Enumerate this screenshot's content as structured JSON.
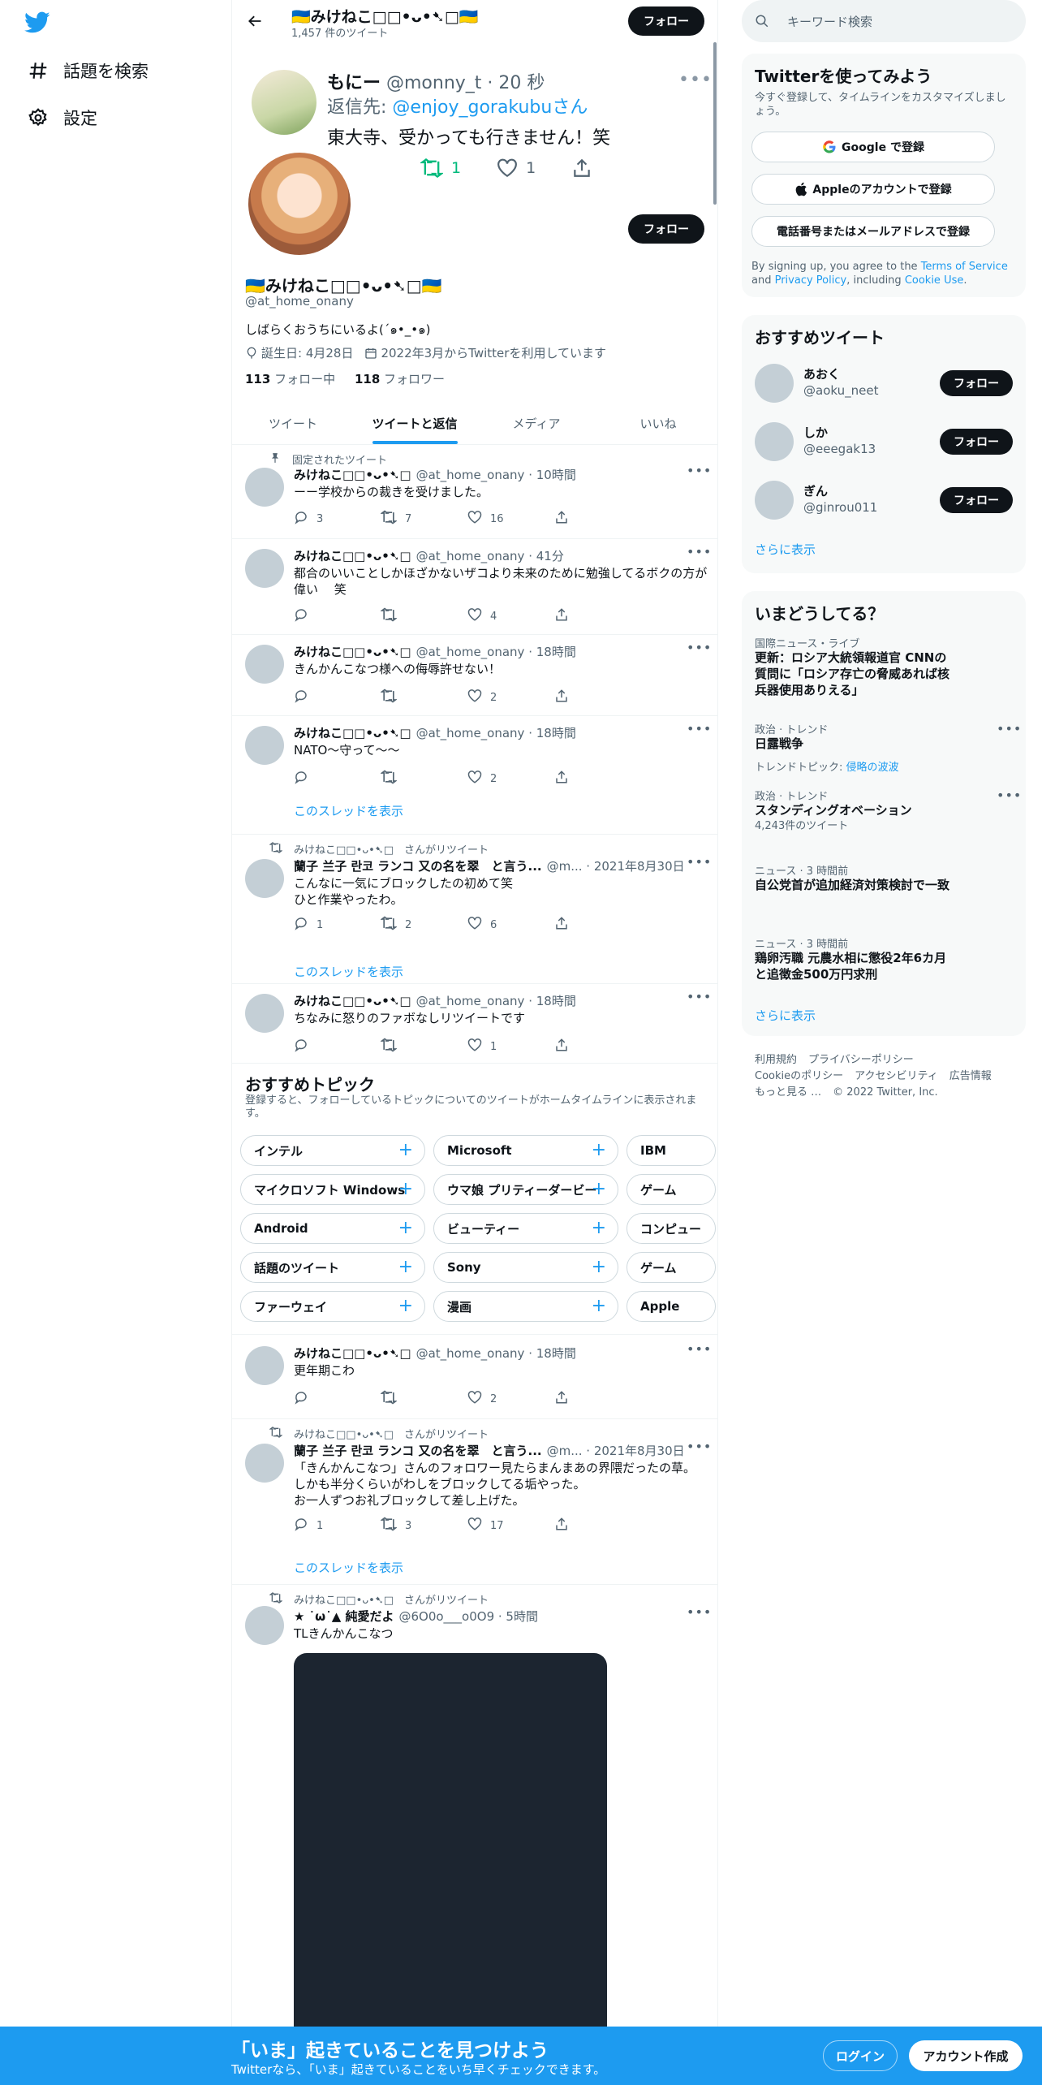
{
  "nav": {
    "explore_label": "話題を検索",
    "settings_label": "設定"
  },
  "header": {
    "name": "🇺🇦みけねこ⁽⁽◟(∗ ˊωˋ ∗)◞⁾⁾🇺🇦",
    "name_display": "🇺🇦みけねこ□□•ᴗ•➷□🇺🇦",
    "tweet_count": "1,457 件のツイート",
    "follow_label": "フォロー"
  },
  "quoted": {
    "name": "もにー",
    "handle": "@monny_t · 20 秒",
    "reply_prefix": "返信先: ",
    "reply_to": "@enjoy_gorakubuさん",
    "text": "東大寺、受かっても行きません！笑",
    "retweets": "1",
    "likes": "1"
  },
  "profile": {
    "name": "🇺🇦みけねこ□□•ᴗ•➷□🇺🇦",
    "handle": "@at_home_onany",
    "bio": "しばらくおうちにいるよ(´๑•_•๑)",
    "birthday": "誕生日: 4月28日",
    "joined": "2022年3月からTwitterを利用しています",
    "following_count": "113",
    "following_label": "フォロー中",
    "followers_count": "118",
    "followers_label": "フォロワー",
    "follow_label": "フォロー"
  },
  "tabs": [
    "ツイート",
    "ツイートと返信",
    "メディア",
    "いいね"
  ],
  "pinned_label": "固定されたツイート",
  "tweets": [
    {
      "name": "みけねこ□□•ᴗ•➷□",
      "meta": "@at_home_onany · 10時間",
      "text": "ーー学校からの裁きを受けました。",
      "replies": "3",
      "retweets": "7",
      "likes": "16"
    },
    {
      "name": "みけねこ□□•ᴗ•➷□",
      "meta": "@at_home_onany · 41分",
      "text": "都合のいいことしかほざかないザコより未来のために勉強してるボクの方が偉い　 笑",
      "replies": "",
      "retweets": "",
      "likes": "4"
    },
    {
      "name": "みけねこ□□•ᴗ•➷□",
      "meta": "@at_home_onany · 18時間",
      "text": "きんかんこなつ様への侮辱許せない！",
      "replies": "",
      "retweets": "",
      "likes": "2"
    },
    {
      "name": "みけねこ□□•ᴗ•➷□",
      "meta": "@at_home_onany · 18時間",
      "text": "NATO〜守って〜〜",
      "replies": "",
      "retweets": "",
      "likes": "2"
    },
    {
      "context": "みけねこ□□•ᴗ•➷□　さんがリツイート",
      "name": "蘭子 兰子 란코 ランコ 又の名を翠　と言う...",
      "meta": "@m... · 2021年8月30日",
      "text": "こんなに一気にブロックしたの初めて笑\nひと作業やったわ。",
      "replies": "1",
      "retweets": "2",
      "likes": "6"
    },
    {
      "name": "みけねこ□□•ᴗ•➷□",
      "meta": "@at_home_onany · 18時間",
      "text": "ちなみに怒りのファボなしリツイートです",
      "replies": "",
      "retweets": "",
      "likes": "1"
    },
    {
      "name": "みけねこ□□•ᴗ•➷□",
      "meta": "@at_home_onany · 18時間",
      "text": "更年期こわ",
      "replies": "",
      "retweets": "",
      "likes": "2"
    },
    {
      "context": "みけねこ□□•ᴗ•➷□　さんがリツイート",
      "name": "蘭子 兰子 란코 ランコ 又の名を翠　と言う...",
      "meta": "@m... · 2021年8月30日",
      "text": "「きんかんこなつ」さんのフォロワー見たらまんまあの界隈だったの草。\nしかも半分くらいがわしをブロックしてる垢やった。\nお一人ずつお礼ブロックして差し上げた。",
      "replies": "1",
      "retweets": "3",
      "likes": "17"
    },
    {
      "context": "みけねこ□□•ᴗ•➷□　さんがリツイート",
      "name": "★ ˙ω˙▲ 純愛だよ",
      "meta": "@6O0o___o0O9 · 5時間",
      "text": "TLきんかんこなつ"
    }
  ],
  "show_thread": "このスレッドを表示",
  "topics": {
    "title": "おすすめトピック",
    "subtitle": "登録すると、フォローしているトピックについてのツイートがホームタイムラインに表示されます。",
    "rows": [
      [
        "インテル",
        "Microsoft",
        "IBM"
      ],
      [
        "マイクロソフト Windows",
        "ウマ娘 プリティーダービー",
        "ゲーム"
      ],
      [
        "Android",
        "ビューティー",
        "コンピュー"
      ],
      [
        "話題のツイート",
        "Sony",
        "ゲーム"
      ],
      [
        "ファーウェイ",
        "漫画",
        "Apple"
      ]
    ]
  },
  "right": {
    "search_placeholder": "キーワード検索",
    "signup": {
      "title": "Twitterを使ってみよう",
      "desc": "今すぐ登録して、タイムラインをカスタマイズしましょう。",
      "google": "Google で登録",
      "apple": "Appleのアカウントで登録",
      "phone": "電話番号またはメールアドレスで登録",
      "legal_pre": "By signing up, you agree to the ",
      "tos": "Terms of Service",
      "and": " and ",
      "privacy": "Privacy Policy",
      "including": ", including ",
      "cookie": "Cookie Use",
      "dot": "."
    },
    "recommend": {
      "title": "おすすめツイート",
      "users": [
        {
          "name": "あおく",
          "handle": "@aoku_neet"
        },
        {
          "name": "しか",
          "handle": "@eeegak13"
        },
        {
          "name": "ぎん",
          "handle": "@ginrou011"
        }
      ],
      "follow_label": "フォロー",
      "more": "さらに表示"
    },
    "trends": {
      "title": "いまどうしてる？",
      "items": [
        {
          "context": "国際ニュース・ライブ",
          "title": "更新：ロシア大統領報道官 CNNの質問に「ロシア存亡の脅威あれば核兵器使用ありえる」",
          "extra": ""
        },
        {
          "context": "政治 · トレンド",
          "title": "日露戦争",
          "extra_pre": "トレンドトピック: ",
          "extra": "侵略の波波"
        },
        {
          "context": "政治 · トレンド",
          "title": "スタンディングオベーション",
          "extra": "4,243件のツイート"
        },
        {
          "context": "ニュース · 3 時間前",
          "title": "自公党首が追加経済対策検討で一致",
          "extra": ""
        },
        {
          "context": "ニュース · 3 時間前",
          "title": "鶏卵汚職 元農水相に懲役2年6カ月と追徴金500万円求刑",
          "extra": ""
        }
      ],
      "more": "さらに表示"
    },
    "footer": [
      "利用規約",
      "プライバシーポリシー",
      "Cookieのポリシー",
      "アクセシビリティ",
      "広告情報",
      "もっと見る …",
      "© 2022 Twitter, Inc."
    ]
  },
  "bottom": {
    "title": "「いま」起きていることを見つけよう",
    "subtitle": "Twitterなら、「いま」起きていることをいち早くチェックできます。",
    "login": "ログイン",
    "signup": "アカウント作成"
  },
  "colors": {
    "accent": "#1d9bf0",
    "dark": "#0f1419",
    "retweet": "#00ba7c"
  }
}
